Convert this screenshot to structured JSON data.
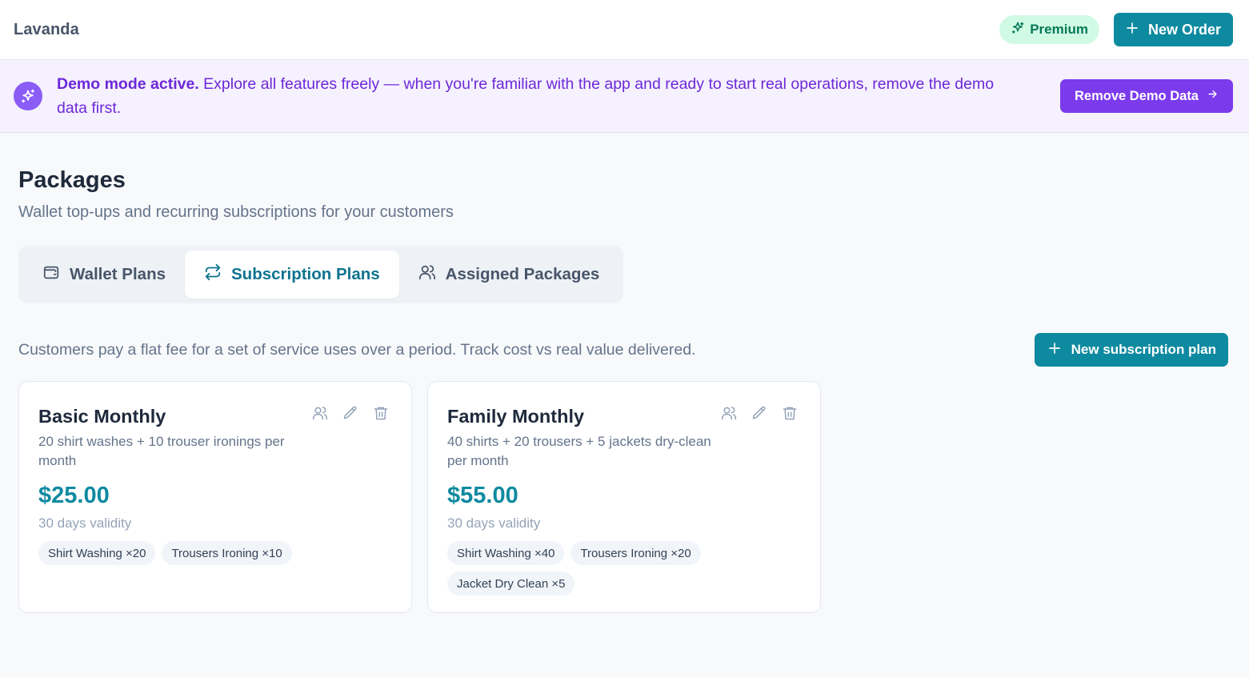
{
  "app": {
    "name": "Lavanda"
  },
  "header": {
    "premium_label": "Premium",
    "new_order_label": "New Order"
  },
  "demo_banner": {
    "title": "Demo mode active.",
    "message": "Explore all features freely — when you're familiar with the app and ready to start real operations, remove the demo data first.",
    "button_label": "Remove Demo Data"
  },
  "page": {
    "title": "Packages",
    "subtitle": "Wallet top-ups and recurring subscriptions for your customers"
  },
  "tabs": [
    {
      "label": "Wallet Plans",
      "icon": "wallet-icon",
      "active": false
    },
    {
      "label": "Subscription Plans",
      "icon": "repeat-icon",
      "active": true
    },
    {
      "label": "Assigned Packages",
      "icon": "users-icon",
      "active": false
    }
  ],
  "subscriptions": {
    "description": "Customers pay a flat fee for a set of service uses over a period. Track cost vs real value delivered.",
    "new_plan_label": "New subscription plan",
    "plans": [
      {
        "name": "Basic Monthly",
        "description": "20 shirt washes + 10 trouser ironings per month",
        "price": "$25.00",
        "validity": "30 days validity",
        "items": [
          "Shirt Washing ×20",
          "Trousers Ironing ×10"
        ]
      },
      {
        "name": "Family Monthly",
        "description": "40 shirts + 20 trousers + 5 jackets dry-clean per month",
        "price": "$55.00",
        "validity": "30 days validity",
        "items": [
          "Shirt Washing ×40",
          "Trousers Ironing ×20",
          "Jacket Dry Clean ×5"
        ]
      }
    ]
  },
  "colors": {
    "primary": "#0e8aa0",
    "demo_accent": "#7c3aed",
    "premium_bg": "#d1fae5",
    "premium_text": "#047857"
  }
}
